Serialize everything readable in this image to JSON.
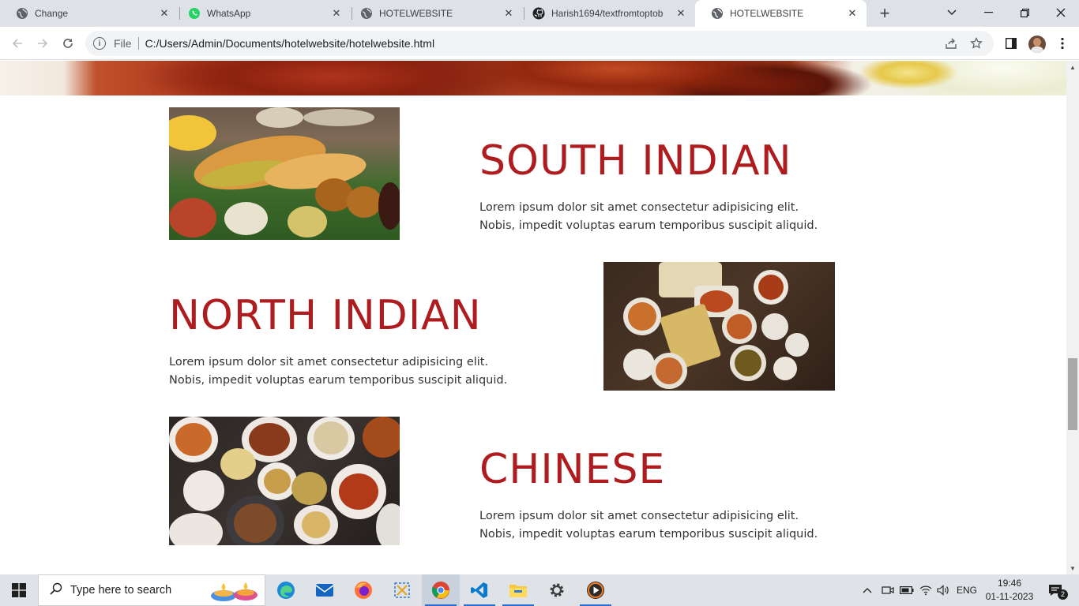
{
  "browser": {
    "tabs": [
      {
        "title": "Change",
        "icon": "globe-icon",
        "active": false
      },
      {
        "title": "WhatsApp",
        "icon": "whatsapp-icon",
        "active": false
      },
      {
        "title": "HOTELWEBSITE",
        "icon": "globe-icon",
        "active": false
      },
      {
        "title": "Harish1694/textfromtoptob",
        "icon": "github-icon",
        "active": false
      },
      {
        "title": "HOTELWEBSITE",
        "icon": "globe-icon",
        "active": true
      }
    ],
    "scheme_label": "File",
    "url": "C:/Users/Admin/Documents/hotelwebsite/hotelwebsite.html"
  },
  "page": {
    "sections": [
      {
        "title": "SOUTH INDIAN",
        "description": "Lorem ipsum dolor sit amet consectetur adipisicing elit. Nobis, impedit voluptas earum temporibus suscipit aliquid.",
        "image": "south-indian-food-image"
      },
      {
        "title": "NORTH INDIAN",
        "description": "Lorem ipsum dolor sit amet consectetur adipisicing elit. Nobis, impedit voluptas earum temporibus suscipit aliquid.",
        "image": "north-indian-food-image"
      },
      {
        "title": "CHINESE",
        "description": "Lorem ipsum dolor sit amet consectetur adipisicing elit. Nobis, impedit voluptas earum temporibus suscipit aliquid.",
        "image": "chinese-food-image"
      }
    ],
    "accent_color": "#ae1c1f"
  },
  "taskbar": {
    "search_placeholder": "Type here to search",
    "language": "ENG",
    "time": "19:46",
    "date": "01-11-2023",
    "notification_count": "2",
    "apps": [
      "edge-icon",
      "mail-icon",
      "firefox-icon",
      "snip-icon",
      "chrome-icon",
      "vscode-icon",
      "file-explorer-icon",
      "settings-icon",
      "media-player-icon"
    ]
  }
}
